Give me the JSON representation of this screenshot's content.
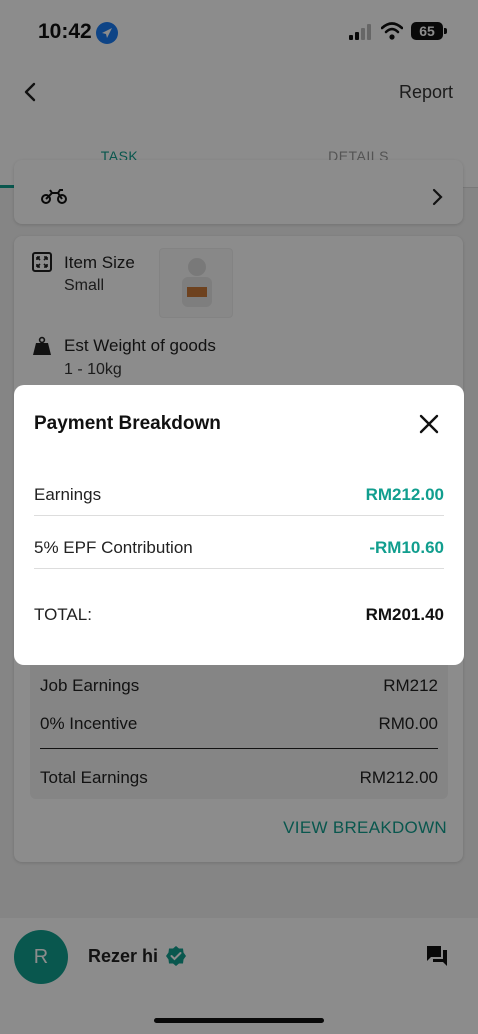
{
  "status_bar": {
    "time": "10:42",
    "battery": "65"
  },
  "header": {
    "report_label": "Report"
  },
  "tabs": [
    {
      "label": "TASK"
    },
    {
      "label": "DETAILS"
    }
  ],
  "details": {
    "item_size_label": "Item Size",
    "item_size_value": "Small",
    "weight_label": "Est Weight of goods",
    "weight_value": "1 - 10kg"
  },
  "earnings": {
    "rows": [
      {
        "label": "Job Earnings",
        "value": "RM212"
      },
      {
        "label": "0% Incentive",
        "value": "RM0.00"
      }
    ],
    "total_label": "Total Earnings",
    "total_value": "RM212.00",
    "view_breakdown_label": "VIEW BREAKDOWN"
  },
  "modal": {
    "title": "Payment Breakdown",
    "rows": [
      {
        "label": "Earnings",
        "value": "RM212.00"
      },
      {
        "label": "5% EPF Contribution",
        "value": "-RM10.60"
      }
    ],
    "total_label": "TOTAL:",
    "total_value": "RM201.40"
  },
  "bottom": {
    "avatar_initial": "R",
    "user_name": "Rezer hi"
  },
  "colors": {
    "accent": "#119e8e",
    "ios_blue": "#1a7cf5",
    "overlay": "rgba(0,0,0,0.45)"
  },
  "icons": {
    "back": "chevron-left-icon",
    "vehicle": "motorcycle-icon",
    "expand": "chevron-right-icon",
    "size": "resize-icon",
    "weight": "weight-icon",
    "close": "close-icon",
    "verified": "verified-badge-icon",
    "chat": "chat-icon"
  }
}
